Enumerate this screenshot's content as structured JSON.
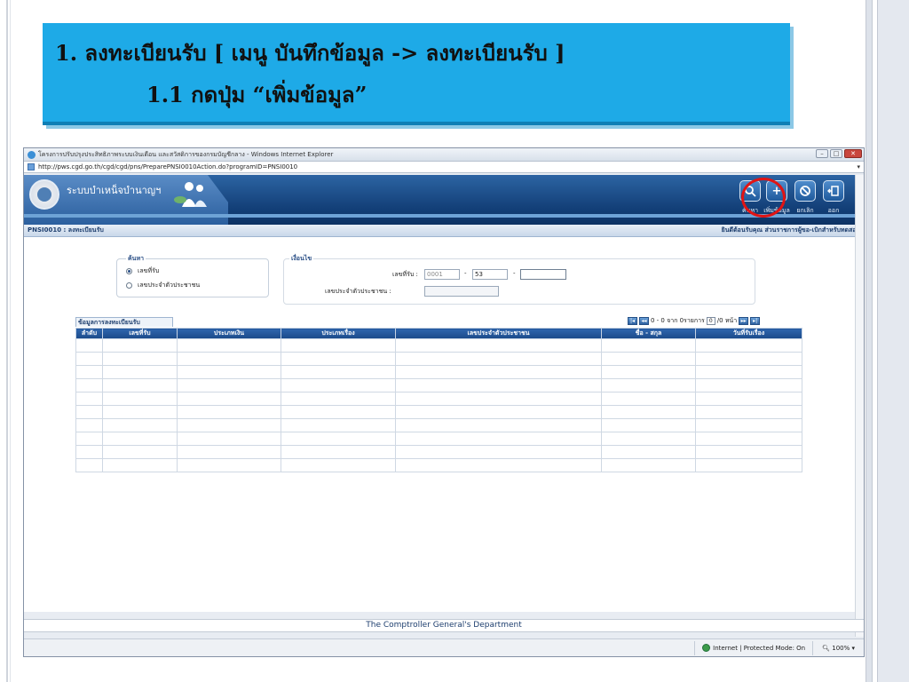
{
  "slide": {
    "title_line1": "1. ลงทะเบียนรับ  [ เมนู บันทึกข้อมูล -> ลงทะเบียนรับ ]",
    "title_line2": "1.1 กดปุ่ม “เพิ่มข้อมูล”"
  },
  "browser": {
    "window_title": "โครงการปรับปรุงประสิทธิภาพระบบเงินเดือน และสวัสดิการของกรมบัญชีกลาง - Windows Internet Explorer",
    "url": "http://pws.cgd.go.th/cgd/cgd/pns/PreparePNSI0010Action.do?programID=PNSI0010",
    "status_zone": "Internet | Protected Mode: On",
    "zoom": "100%"
  },
  "app": {
    "name": "ระบบบำเหน็จบำนาญฯ",
    "toolbar": {
      "search": "ค้นหา",
      "add": "เพิ่มข้อมูล",
      "cancel": "ยกเลิก",
      "exit": "ออก"
    },
    "page_code": "PNSI0010 : ลงทะเบียนรับ",
    "welcome": "ยินดีต้อนรับคุณ ส่วนราชการผู้ขอ-เบิกสำหรับทดสอบ",
    "search_panel": {
      "legend": "ค้นหา",
      "options": [
        "เลขที่รับ",
        "เลขประจำตัวประชาชน"
      ],
      "selected_index": 0
    },
    "condition_panel": {
      "legend": "เงื่อนไข",
      "receive_no_label": "เลขที่รับ :",
      "receive_no_part1": "0001",
      "receive_no_part2": "53",
      "receive_no_part3": "",
      "id_card_label": "เลขประจำตัวประชาชน :",
      "id_card_value": ""
    },
    "grid": {
      "caption": "ข้อมูลการลงทะเบียนรับ",
      "pager_text": "0 - 0 จาก 0รายการ",
      "page_value": "0",
      "page_total": "/0 หน้า",
      "columns": [
        "ลำดับ",
        "เลขที่รับ",
        "ประเภทเงิน",
        "ประเภทเรื่อง",
        "เลขประจำตัวประชาชน",
        "ชื่อ - สกุล",
        "วันที่รับเรื่อง"
      ],
      "row_count": 10
    },
    "footer": "The Comptroller General's Department"
  },
  "colors": {
    "title_box": "#1eaae7",
    "header_blue": "#123e76",
    "highlight_circle": "#e11414"
  }
}
